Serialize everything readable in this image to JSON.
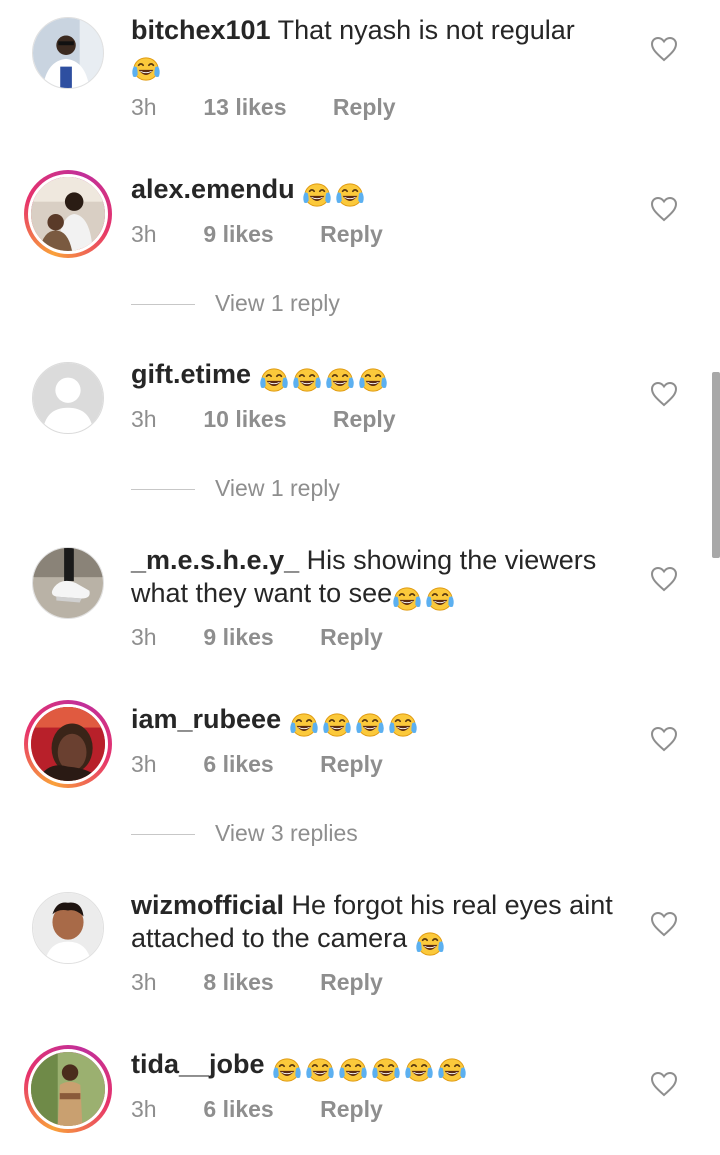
{
  "comments": [
    {
      "username": "bitchex101",
      "text": "That nyash is  not regular",
      "emoji_count": 1,
      "time": "3h",
      "likes": "13 likes",
      "reply": "Reply"
    },
    {
      "username": "alex.emendu",
      "text": "",
      "emoji_count": 2,
      "time": "3h",
      "likes": "9 likes",
      "reply": "Reply",
      "view_replies": "View 1 reply"
    },
    {
      "username": "gift.etime",
      "text": "",
      "emoji_count": 4,
      "time": "3h",
      "likes": "10 likes",
      "reply": "Reply",
      "view_replies": "View 1 reply"
    },
    {
      "username": "_m.e.s.h.e.y_",
      "text": "His showing the viewers what they want to see",
      "emoji_count": 2,
      "time": "3h",
      "likes": "9 likes",
      "reply": "Reply"
    },
    {
      "username": "iam_rubeee",
      "text": "",
      "emoji_count": 4,
      "time": "3h",
      "likes": "6 likes",
      "reply": "Reply",
      "view_replies": "View 3 replies"
    },
    {
      "username": "wizmofficial",
      "text": "He forgot his real eyes aint attached to the camera",
      "emoji_count": 1,
      "time": "3h",
      "likes": "8 likes",
      "reply": "Reply"
    },
    {
      "username": "tida__jobe",
      "text": "",
      "emoji_count": 6,
      "time": "3h",
      "likes": "6 likes",
      "reply": "Reply"
    }
  ],
  "icons": {
    "emoji": "face-with-tears-of-joy-icon",
    "like": "heart-outline-icon"
  },
  "colors": {
    "text": "#262626",
    "meta": "#8e8e8e",
    "story_ring_start": "#f9a13a",
    "story_ring_end": "#c12f9a"
  }
}
